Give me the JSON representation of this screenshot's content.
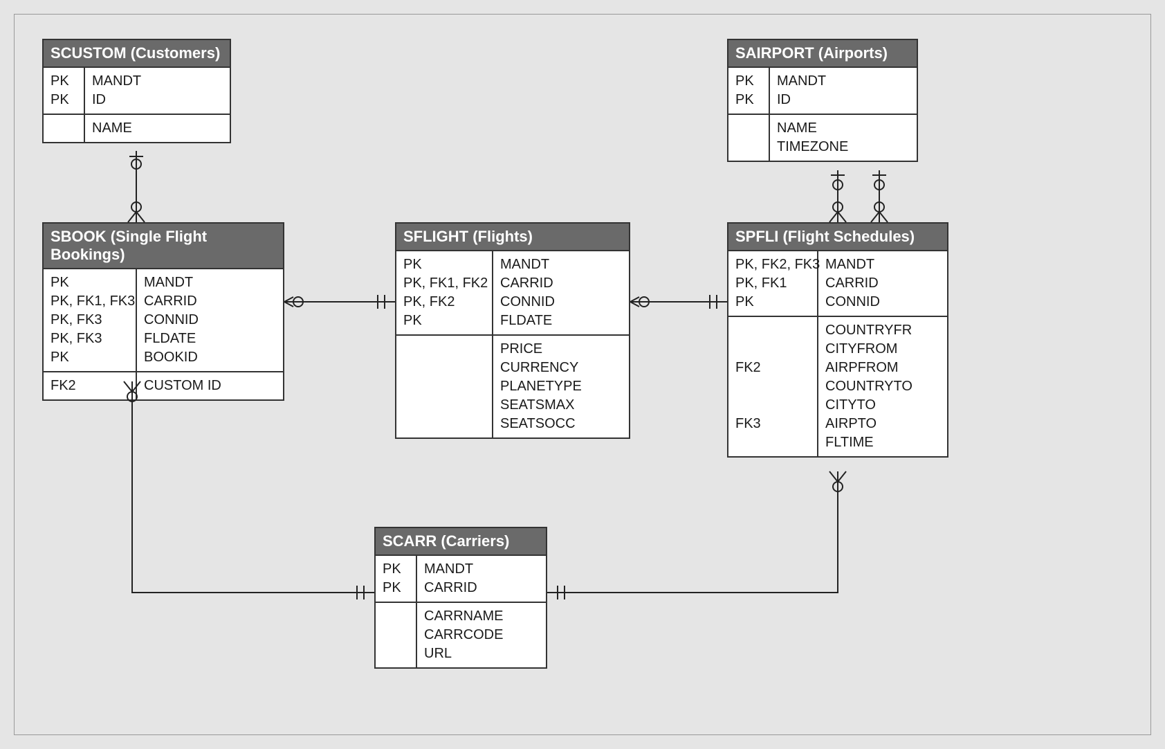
{
  "diagram_type": "entity-relationship",
  "entities": {
    "scustom": {
      "title": "SCUSTOM (Customers)",
      "sections": [
        {
          "keys": "PK\nPK",
          "fields": "MANDT\nID"
        },
        {
          "keys": "",
          "fields": "NAME"
        }
      ]
    },
    "sbook": {
      "title": "SBOOK (Single Flight Bookings)",
      "sections": [
        {
          "keys": "PK\nPK, FK1, FK3\nPK, FK3\nPK, FK3\nPK",
          "fields": "MANDT\nCARRID\nCONNID\nFLDATE\nBOOKID"
        },
        {
          "keys": "FK2",
          "fields": "CUSTOM ID"
        }
      ]
    },
    "sflight": {
      "title": "SFLIGHT (Flights)",
      "sections": [
        {
          "keys": "PK\nPK, FK1, FK2\nPK, FK2\nPK",
          "fields": "MANDT\nCARRID\nCONNID\nFLDATE"
        },
        {
          "keys": "",
          "fields": "PRICE\nCURRENCY\nPLANETYPE\nSEATSMAX\nSEATSOCC"
        }
      ]
    },
    "spfli": {
      "title": "SPFLI (Flight Schedules)",
      "sections": [
        {
          "keys": "PK, FK2, FK3\nPK, FK1\nPK",
          "fields": "MANDT\nCARRID\nCONNID"
        },
        {
          "keys": "\n\nFK2\n\n\nFK3\n",
          "fields": "COUNTRYFR\nCITYFROM\nAIRPFROM\nCOUNTRYTO\nCITYTO\nAIRPTO\nFLTIME"
        }
      ]
    },
    "sairport": {
      "title": "SAIRPORT (Airports)",
      "sections": [
        {
          "keys": "PK\nPK",
          "fields": "MANDT\nID"
        },
        {
          "keys": "",
          "fields": "NAME\nTIMEZONE"
        }
      ]
    },
    "scarr": {
      "title": "SCARR (Carriers)",
      "sections": [
        {
          "keys": "PK\nPK",
          "fields": "MANDT\nCARRID"
        },
        {
          "keys": "",
          "fields": "CARRNAME\nCARRCODE\nURL"
        }
      ]
    }
  },
  "relationships": [
    {
      "from": "SCUSTOM",
      "to": "SBOOK",
      "type": "one-to-many"
    },
    {
      "from": "SBOOK",
      "to": "SFLIGHT",
      "type": "zero-or-one-to-one"
    },
    {
      "from": "SFLIGHT",
      "to": "SPFLI",
      "type": "zero-or-one-to-one"
    },
    {
      "from": "SAIRPORT",
      "to": "SPFLI",
      "type": "two one-to-many (airpfrom, airpto)"
    },
    {
      "from": "SCARR",
      "to": "SBOOK",
      "type": "one-to-many"
    },
    {
      "from": "SCARR",
      "to": "SPFLI",
      "type": "one-to-many"
    }
  ]
}
